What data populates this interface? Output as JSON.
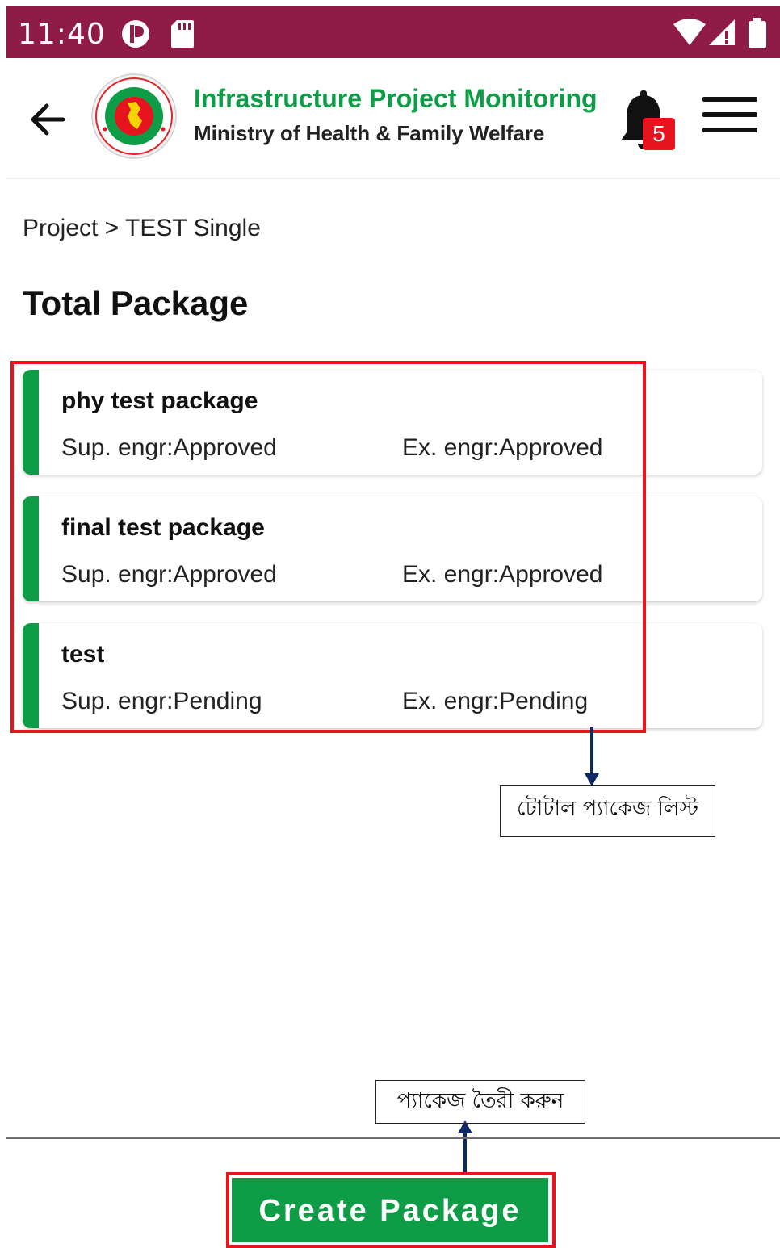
{
  "status_bar": {
    "time": "11:40"
  },
  "header": {
    "title": "Infrastructure Project Monitoring",
    "subtitle": "Ministry of Health & Family Welfare",
    "notification_count": "5"
  },
  "breadcrumb": "Project > TEST Single",
  "page_title": "Total Package",
  "packages": [
    {
      "name": "phy test package",
      "sup": "Sup. engr:Approved",
      "ex": "Ex. engr:Approved"
    },
    {
      "name": "final test package",
      "sup": "Sup. engr:Approved",
      "ex": "Ex. engr:Approved"
    },
    {
      "name": "test",
      "sup": "Sup. engr:Pending",
      "ex": "Ex. engr:Pending"
    }
  ],
  "annotations": {
    "list_label": "টোটাল প্যাকেজ লিস্ট",
    "create_label": "প্যাকেজ তৈরী করুন"
  },
  "create_button": "Create Package",
  "colors": {
    "status_bar": "#8f1c47",
    "accent_green": "#0e9d46",
    "highlight_red": "#e8141c",
    "arrow_navy": "#0d2a66"
  },
  "icons": {
    "back": "arrow-left-icon",
    "notification": "bell-icon",
    "menu": "hamburger-menu-icon",
    "logo": "government-seal-logo"
  }
}
